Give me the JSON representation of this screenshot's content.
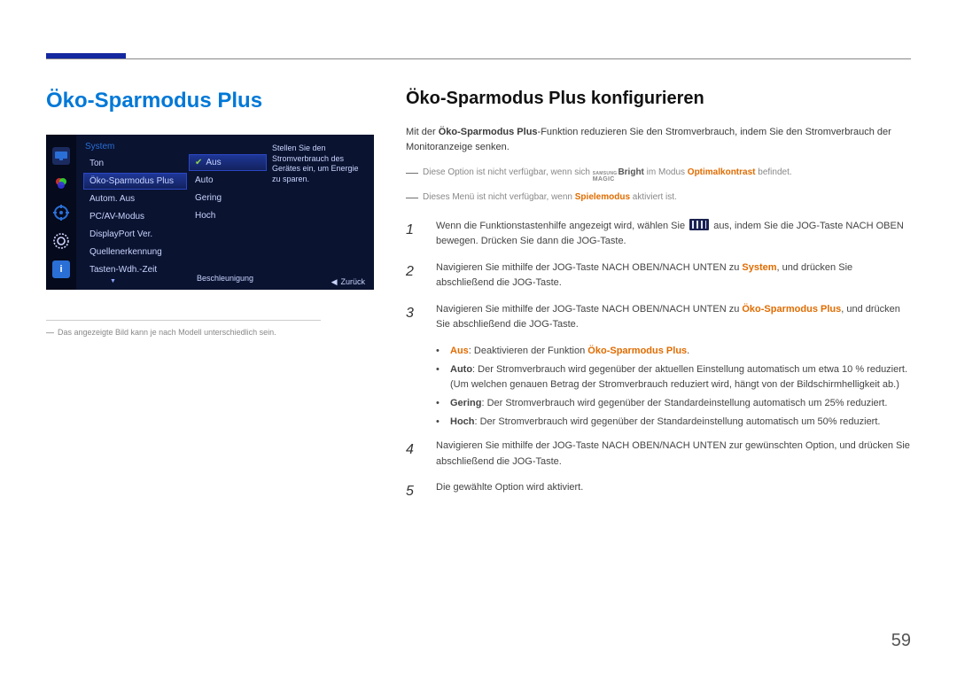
{
  "page_number": "59",
  "left": {
    "title": "Öko-Sparmodus Plus",
    "osd": {
      "header": "System",
      "menu": [
        "Ton",
        "Öko-Sparmodus Plus",
        "Autom. Aus",
        "PC/AV-Modus",
        "DisplayPort Ver.",
        "Quellenerkennung",
        "Tasten-Wdh.-Zeit"
      ],
      "selected_menu_index": 1,
      "submenu": [
        "Aus",
        "Auto",
        "Gering",
        "Hoch"
      ],
      "selected_sub_index": 0,
      "desc": "Stellen Sie den Stromverbrauch des Gerätes ein, um Energie zu sparen.",
      "footer_left": "Beschleunigung",
      "footer_right": "Zurück"
    },
    "caption": "Das angezeigte Bild kann je nach Modell unterschiedlich sein."
  },
  "right": {
    "heading": "Öko-Sparmodus Plus konfigurieren",
    "intro_pre": "Mit der ",
    "intro_bold": "Öko-Sparmodus Plus",
    "intro_post": "-Funktion reduzieren Sie den Stromverbrauch, indem Sie den Stromverbrauch der Monitoranzeige senken.",
    "note1_pre": "Diese Option ist nicht verfügbar, wenn sich ",
    "note1_magic_top": "SAMSUNG",
    "note1_magic_bottom": "MAGIC",
    "note1_bright": "Bright",
    "note1_mid": " im Modus ",
    "note1_orange": "Optimalkontrast",
    "note1_post": " befindet.",
    "note2_pre": "Dieses Menü ist nicht verfügbar, wenn ",
    "note2_orange": "Spielemodus",
    "note2_post": " aktiviert ist.",
    "steps": {
      "s1a": "Wenn die Funktionstastenhilfe angezeigt wird, wählen Sie ",
      "s1b": " aus, indem Sie die JOG-Taste NACH OBEN bewegen. Drücken Sie dann die JOG-Taste.",
      "s2_pre": "Navigieren Sie mithilfe der JOG-Taste NACH OBEN/NACH UNTEN zu ",
      "s2_orange": "System",
      "s2_post": ", und drücken Sie abschließend die JOG-Taste.",
      "s3_pre": "Navigieren Sie mithilfe der JOG-Taste NACH OBEN/NACH UNTEN zu ",
      "s3_orange": "Öko-Sparmodus Plus",
      "s3_post": ", und drücken Sie abschließend die JOG-Taste.",
      "s4": "Navigieren Sie mithilfe der JOG-Taste NACH OBEN/NACH UNTEN zur gewünschten Option, und drücken Sie abschließend die JOG-Taste.",
      "s5": "Die gewählte Option wird aktiviert."
    },
    "bullets": {
      "b1_key": "Aus",
      "b1_mid": ": Deaktivieren der Funktion ",
      "b1_key2": "Öko-Sparmodus Plus",
      "b1_end": ".",
      "b2_key": "Auto",
      "b2_txt": ": Der Stromverbrauch wird gegenüber der aktuellen Einstellung automatisch um etwa 10 % reduziert. (Um welchen genauen Betrag der Stromverbrauch reduziert wird, hängt von der Bildschirmhelligkeit ab.)",
      "b3_key": "Gering",
      "b3_txt": ": Der Stromverbrauch wird gegenüber der Standardeinstellung automatisch um 25% reduziert.",
      "b4_key": "Hoch",
      "b4_txt": ": Der Stromverbrauch wird gegenüber der Standardeinstellung automatisch um 50% reduziert."
    }
  }
}
